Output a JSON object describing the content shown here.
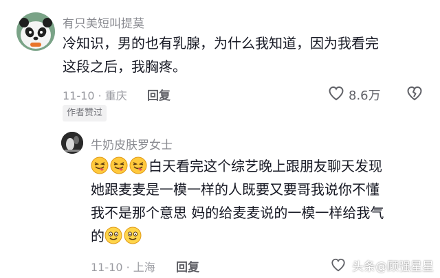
{
  "comments": [
    {
      "username": "有只美短叫提莫",
      "text_line1": "冷知识，男的也有乳腺，为什么我知道，因为我看完",
      "text_line2": "这段之后，我胸疼。",
      "date": "11-10",
      "location": "重庆",
      "reply_label": "回复",
      "like_count": "8.6万",
      "badge": "作者赞过"
    },
    {
      "username": "牛奶皮肤罗女士",
      "text_line1": "白天看完这个综艺晚上跟朋友聊天发现",
      "text_line2": "她跟麦麦是一模一样的人既要又要哥我说你不懂",
      "text_line3": "我不是那个意思 妈的给麦麦说的一模一样给我气",
      "text_line4": "的",
      "date": "11-10",
      "location": "上海",
      "reply_label": "回复"
    }
  ],
  "watermark": {
    "text": "头条@顾强星星"
  },
  "icons": [
    "panda-avatar-icon",
    "heart-icon",
    "broken-heart-icon",
    "tongue-emoji-icon",
    "smile-emoji-icon"
  ],
  "colors": {
    "text": "#161823",
    "username": "#8a8b91",
    "meta": "#9a9ba1",
    "badge_bg": "#f1f1f2"
  }
}
